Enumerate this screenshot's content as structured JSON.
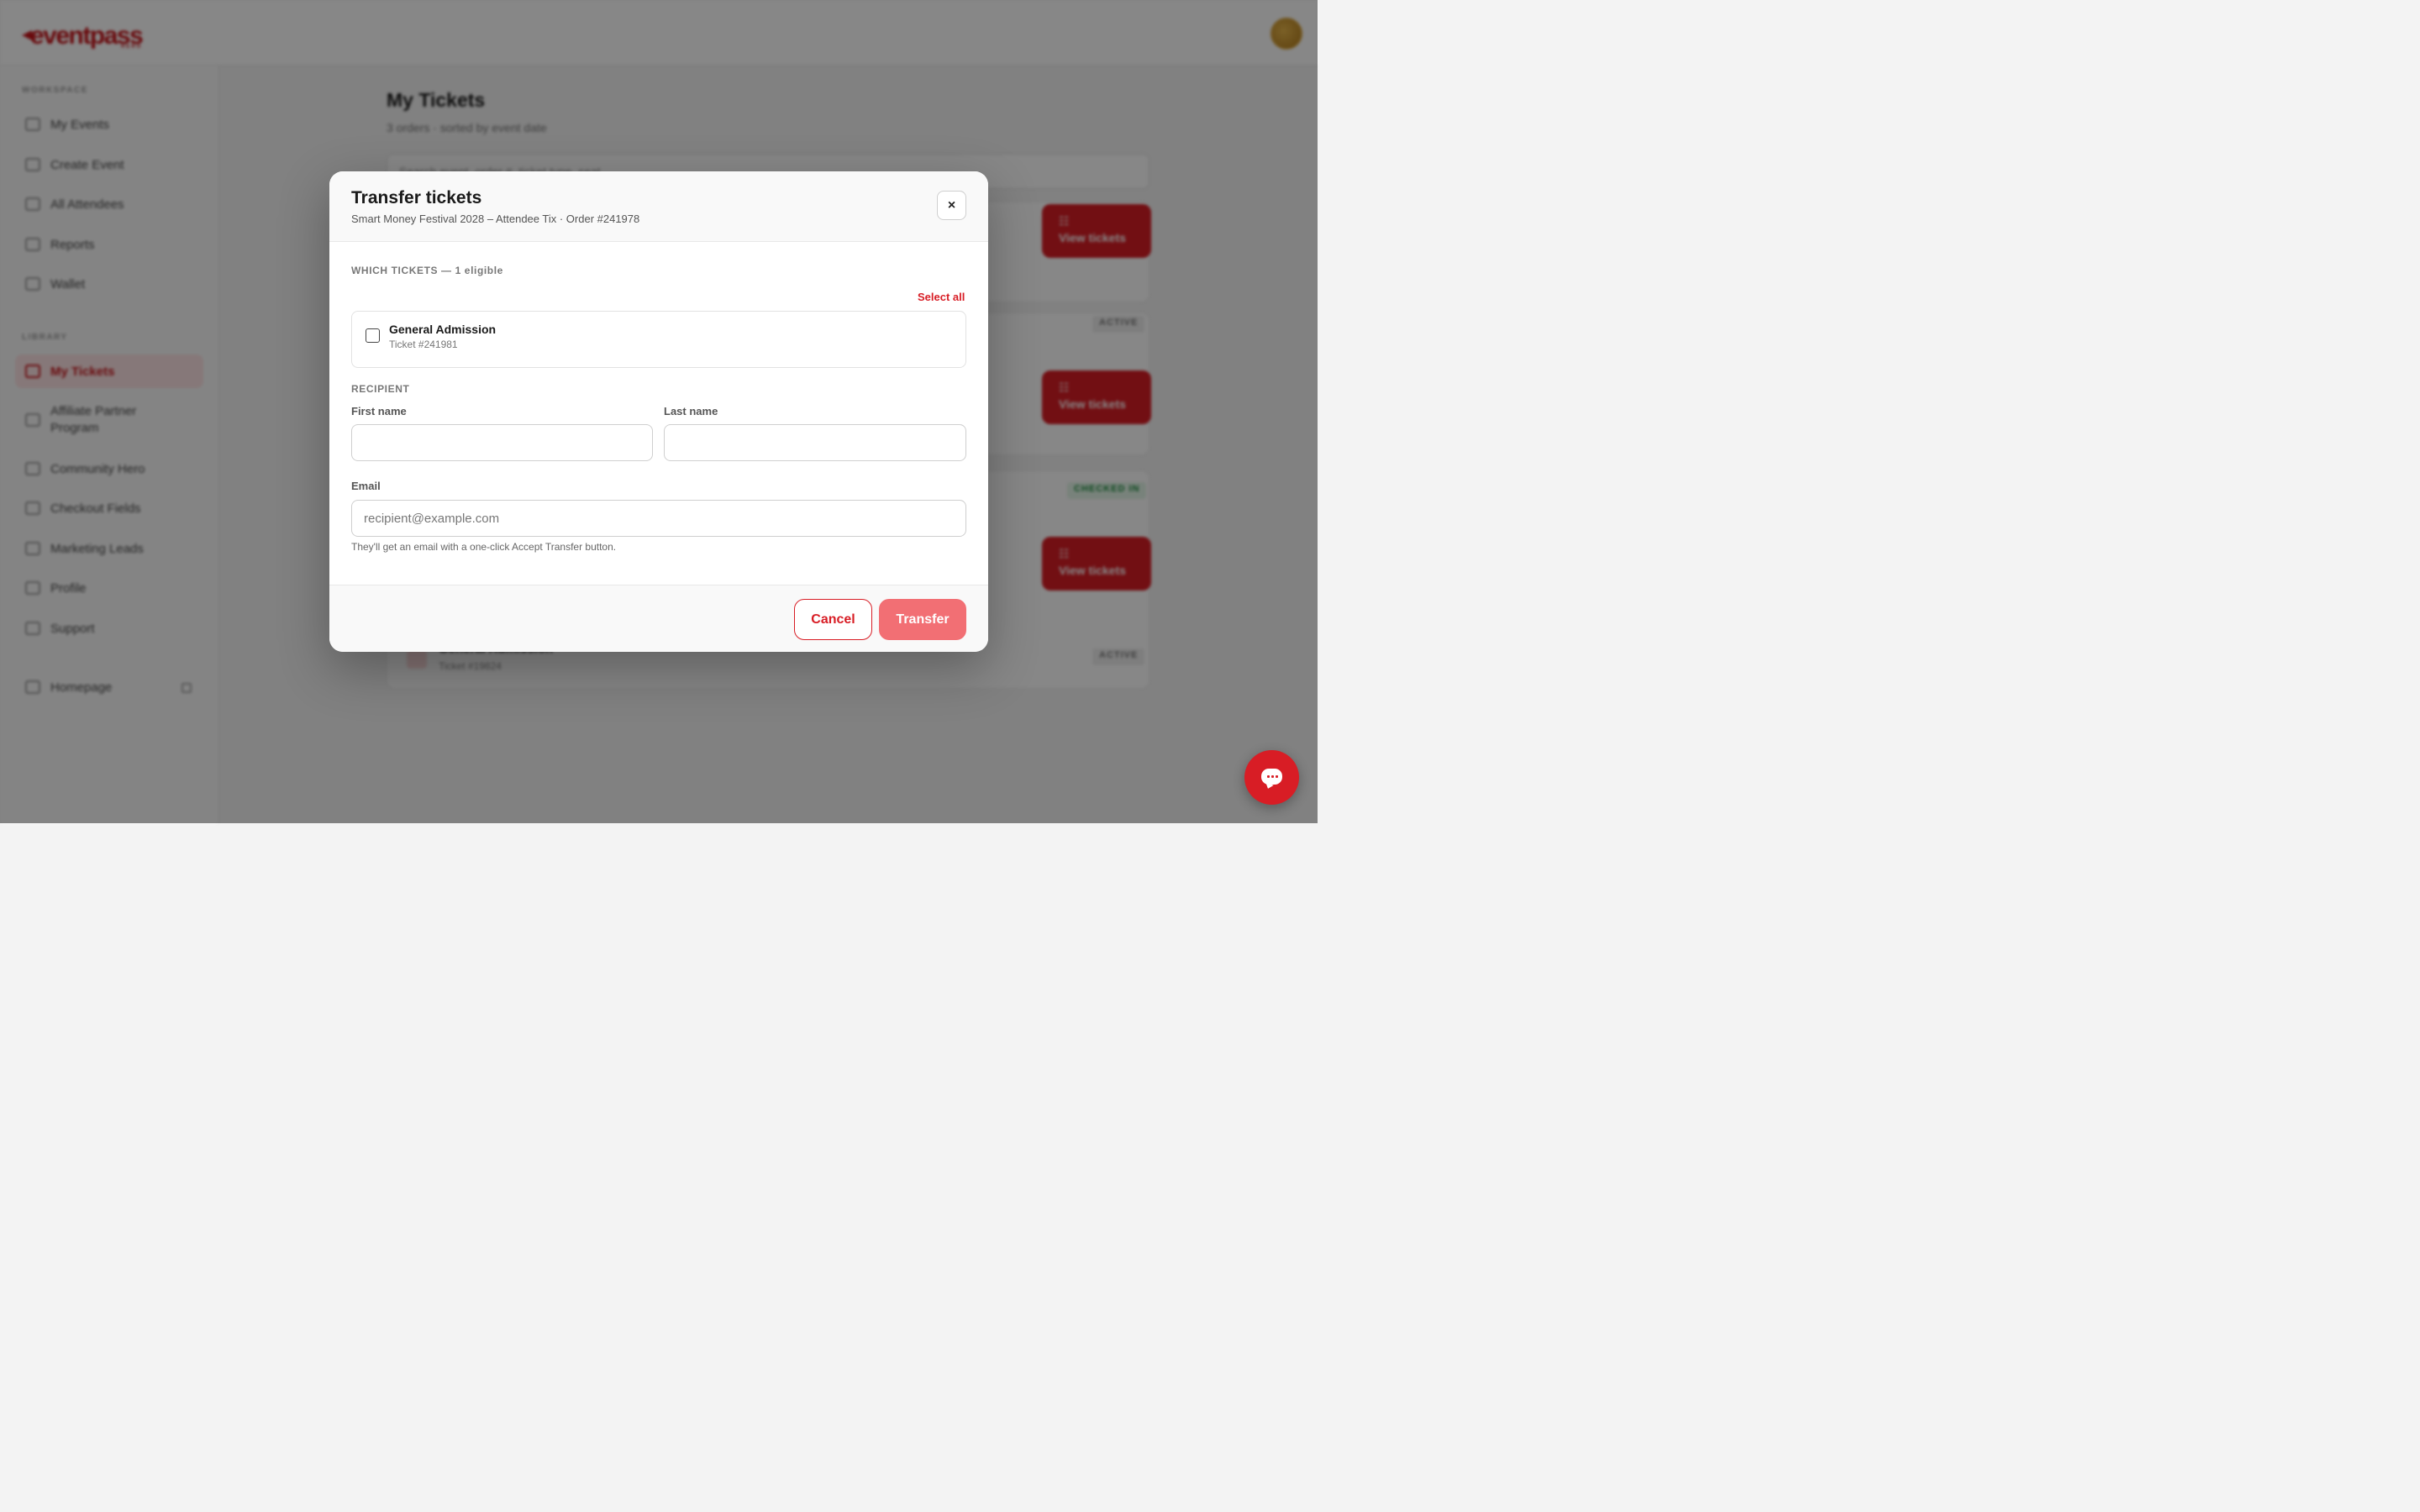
{
  "app": {
    "logo_text": "eventpass",
    "logo_sub": "HERO"
  },
  "sidebar": {
    "workspace_label": "WORKSPACE",
    "library_label": "LIBRARY",
    "workspace_items": [
      {
        "label": "My Events",
        "icon": "grid-icon"
      },
      {
        "label": "Create Event",
        "icon": "plus-icon"
      },
      {
        "label": "All Attendees",
        "icon": "users-icon"
      },
      {
        "label": "Reports",
        "icon": "chart-icon"
      },
      {
        "label": "Wallet",
        "icon": "wallet-icon"
      }
    ],
    "library_items": [
      {
        "label": "My Tickets",
        "icon": "ticket-icon",
        "active": true
      },
      {
        "label": "Affiliate Partner Program",
        "icon": "trophy-icon"
      },
      {
        "label": "Community Hero",
        "icon": "megaphone-icon"
      },
      {
        "label": "Checkout Fields",
        "icon": "clipboard-icon"
      },
      {
        "label": "Marketing Leads",
        "icon": "mail-icon"
      },
      {
        "label": "Profile",
        "icon": "user-icon"
      },
      {
        "label": "Support",
        "icon": "support-icon"
      }
    ],
    "homepage_label": "Homepage"
  },
  "main": {
    "title": "My Tickets",
    "subtitle": "3 orders · sorted by event date",
    "search_placeholder": "Search event, order #, ticket type, seat",
    "view_tickets_label": "View tickets",
    "badges": [
      "ACTIVE",
      "CHECKED IN",
      "ACTIVE"
    ],
    "bg_ticket": {
      "name": "General Admission",
      "number": "Ticket #19824"
    }
  },
  "modal": {
    "title": "Transfer tickets",
    "subtitle": "Smart Money Festival 2028 – Attendee Tix · Order #241978",
    "close_label": "×",
    "which_label": "WHICH TICKETS — 1 eligible",
    "select_all_label": "Select all",
    "ticket": {
      "name": "General Admission",
      "number": "Ticket #241981",
      "checked": false
    },
    "recipient_label": "RECIPIENT",
    "first_name_label": "First name",
    "first_name_value": "",
    "last_name_label": "Last name",
    "last_name_value": "",
    "email_label": "Email",
    "email_placeholder": "recipient@example.com",
    "email_value": "",
    "hint": "They'll get an email with a one-click Accept Transfer button.",
    "cancel_label": "Cancel",
    "transfer_label": "Transfer"
  },
  "colors": {
    "brand": "#d81d25",
    "transfer_disabled": "#f26f74",
    "overlay": "rgba(0,0,0,0.47)"
  }
}
